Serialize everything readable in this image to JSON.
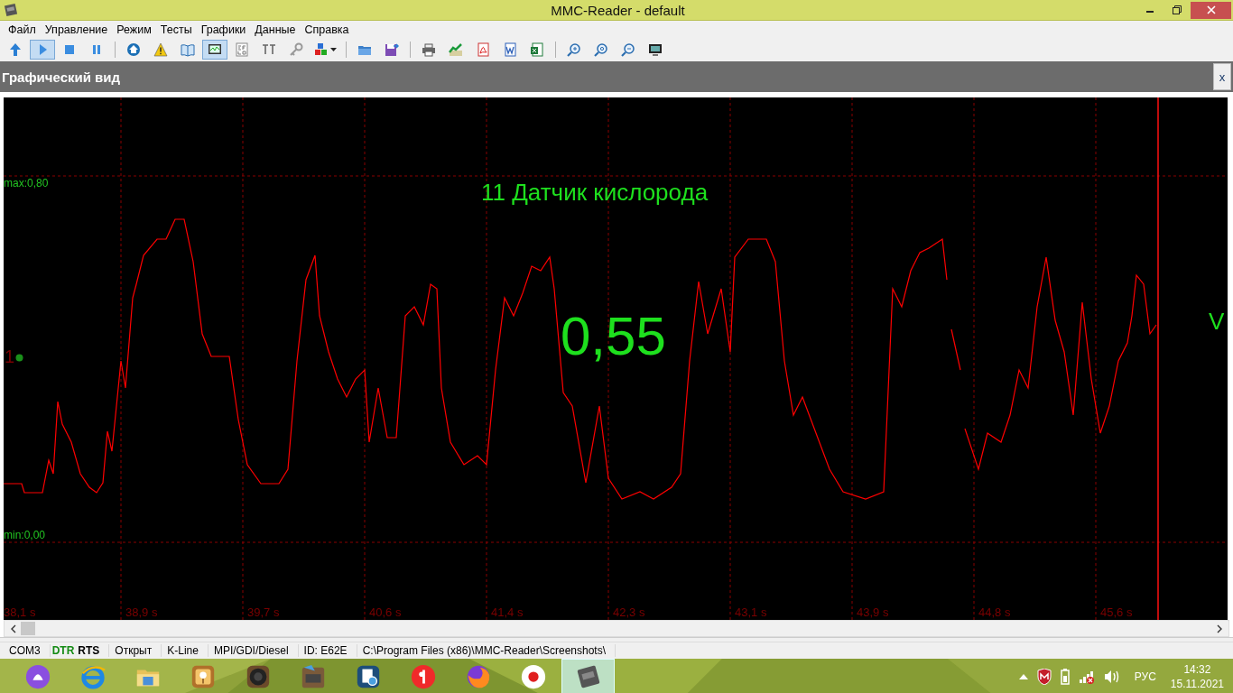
{
  "window": {
    "title": "MMC-Reader - default"
  },
  "menu": [
    {
      "label": "Файл"
    },
    {
      "label": "Управление"
    },
    {
      "label": "Режим"
    },
    {
      "label": "Тесты"
    },
    {
      "label": "Графики"
    },
    {
      "label": "Данные"
    },
    {
      "label": "Справка"
    }
  ],
  "toolbar": [
    [
      {
        "selected": false
      },
      {
        "selected": true
      },
      {
        "selected": false
      },
      {
        "selected": false
      }
    ],
    [
      {
        "selected": false
      },
      {
        "selected": false
      },
      {
        "selected": false
      },
      {
        "selected": true
      },
      {
        "selected": false
      },
      {
        "selected": false
      },
      {
        "selected": false
      },
      {
        "selected": false
      }
    ],
    [
      {
        "selected": false
      },
      {
        "selected": false
      }
    ],
    [
      {
        "selected": false
      },
      {
        "selected": false
      },
      {
        "selected": false
      },
      {
        "selected": false
      },
      {
        "selected": false
      }
    ],
    [
      {
        "selected": false
      },
      {
        "selected": false
      },
      {
        "selected": false
      },
      {
        "selected": false
      }
    ]
  ],
  "panel": {
    "title": "Графический вид",
    "close": "x"
  },
  "graph": {
    "title": "11 Датчик кислорода",
    "value": "0,55",
    "unit": "V",
    "max_label": "max:0,80",
    "min_label": "min:0,00",
    "channel": "1",
    "time_ticks": [
      "38,1 s",
      "38,9 s",
      "39,7 s",
      "40,6 s",
      "41,4 s",
      "42,3 s",
      "43,1 s",
      "43,9 s",
      "44,8 s",
      "45,6 s"
    ]
  },
  "status_bar": [
    {
      "kind": "cell",
      "text": "COM3"
    },
    {
      "kind": "signal",
      "text": "DTR",
      "color": "#138a13"
    },
    {
      "kind": "signal",
      "text": "RTS",
      "color": "#000000"
    },
    {
      "kind": "cell",
      "text": "Открыт"
    },
    {
      "kind": "cell",
      "text": "K-Line"
    },
    {
      "kind": "cell",
      "text": "MPI/GDI/Diesel"
    },
    {
      "kind": "cell",
      "text": "ID: E62E"
    },
    {
      "kind": "cell",
      "text": "C:\\Program Files (x86)\\MMC-Reader\\Screenshots\\"
    }
  ],
  "taskbar": {
    "apps": [
      {
        "selected": false
      },
      {
        "selected": false
      },
      {
        "selected": false
      },
      {
        "selected": false
      },
      {
        "selected": false
      },
      {
        "selected": false
      },
      {
        "selected": false
      },
      {
        "selected": false
      },
      {
        "selected": false
      },
      {
        "selected": false
      },
      {
        "selected": true
      }
    ],
    "language": "РУС",
    "time": "14:32",
    "date": "15.11.2021"
  }
}
